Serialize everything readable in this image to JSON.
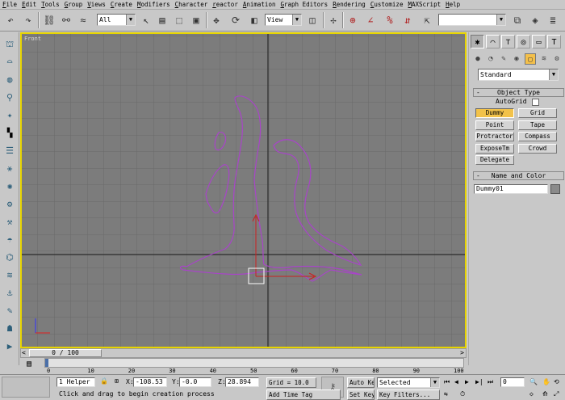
{
  "menu": [
    "File",
    "Edit",
    "Tools",
    "Group",
    "Views",
    "Create",
    "Modifiers",
    "Character",
    "reactor",
    "Animation",
    "Graph Editors",
    "Rendering",
    "Customize",
    "MAXScript",
    "Help"
  ],
  "toolbar": {
    "selection_filter": "All",
    "ref_coord": "View",
    "named_selection": ""
  },
  "viewport": {
    "label": "Front",
    "colors": {
      "background": "#7c7c7c",
      "grid": "#6a6a6a",
      "axis": "#2b2b2b",
      "shape": "#a845c8",
      "border": "#e7d400"
    }
  },
  "cmdpanel": {
    "category_dropdown": "Standard",
    "object_type_header": "Object Type",
    "autogrid_label": "AutoGrid",
    "buttons": [
      "Dummy",
      "Grid",
      "Point",
      "Tape",
      "Protractor",
      "Compass",
      "ExposeTm",
      "Crowd",
      "Delegate"
    ],
    "active_button": "Dummy",
    "name_color_header": "Name and Color",
    "object_name": "Dummy01",
    "object_color": "#8a8a8a"
  },
  "timeslider": {
    "frame_label": "0 / 100",
    "ticks": [
      "0",
      "10",
      "20",
      "30",
      "40",
      "50",
      "60",
      "70",
      "80",
      "90",
      "100"
    ]
  },
  "status": {
    "selection_count": "1 Helper",
    "x_label": "X:",
    "x_value": "-108.53",
    "y_label": "Y:",
    "y_value": "-0.0",
    "z_label": "Z:",
    "z_value": "28.894",
    "grid_label": "Grid = 10.0",
    "prompt": "Click and drag to begin creation process",
    "add_time_tag": "Add Time Tag",
    "auto_key": "Auto Key",
    "set_key": "Set Key",
    "key_mode": "Selected",
    "key_filters": "Key Filters...",
    "frame_value": "0"
  }
}
